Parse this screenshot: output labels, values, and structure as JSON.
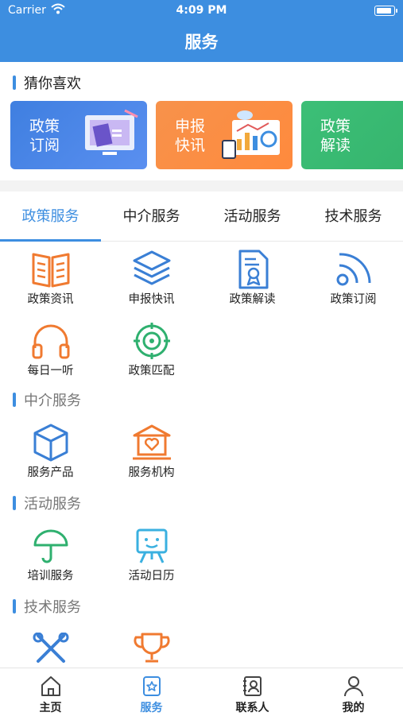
{
  "status_bar": {
    "carrier": "Carrier",
    "time": "4:09 PM"
  },
  "nav": {
    "title": "服务"
  },
  "guess": {
    "title": "猜你喜欢",
    "cards": [
      {
        "label": "政策订阅",
        "color": "#3f7fe0"
      },
      {
        "label": "申报快讯",
        "color": "#f7924b"
      },
      {
        "label": "政策解读",
        "color": "#3cbf77"
      }
    ]
  },
  "tabs": [
    {
      "label": "政策服务",
      "active": true
    },
    {
      "label": "中介服务",
      "active": false
    },
    {
      "label": "活动服务",
      "active": false
    },
    {
      "label": "技术服务",
      "active": false
    }
  ],
  "policy_items": [
    {
      "label": "政策资讯",
      "icon": "book-icon"
    },
    {
      "label": "申报快讯",
      "icon": "layers-icon"
    },
    {
      "label": "政策解读",
      "icon": "document-award-icon"
    },
    {
      "label": "政策订阅",
      "icon": "rss-icon"
    },
    {
      "label": "每日一听",
      "icon": "headphones-icon"
    },
    {
      "label": "政策匹配",
      "icon": "target-icon"
    }
  ],
  "intermediary": {
    "title": "中介服务",
    "items": [
      {
        "label": "服务产品",
        "icon": "cube-icon"
      },
      {
        "label": "服务机构",
        "icon": "institution-icon"
      }
    ]
  },
  "activity": {
    "title": "活动服务",
    "items": [
      {
        "label": "培训服务",
        "icon": "umbrella-icon"
      },
      {
        "label": "活动日历",
        "icon": "easel-icon"
      }
    ]
  },
  "tech": {
    "title": "技术服务",
    "items": [
      {
        "label": "",
        "icon": "tools-icon"
      },
      {
        "label": "",
        "icon": "trophy-icon"
      }
    ]
  },
  "tabbar": [
    {
      "label": "主页",
      "icon": "home-icon",
      "active": false
    },
    {
      "label": "服务",
      "icon": "service-star-icon",
      "active": true
    },
    {
      "label": "联系人",
      "icon": "contacts-icon",
      "active": false
    },
    {
      "label": "我的",
      "icon": "user-icon",
      "active": false
    }
  ],
  "colors": {
    "primary": "#3d8ee0",
    "orange": "#f07a30",
    "green": "#2fb06f",
    "icon_blue": "#3a7fd5"
  }
}
